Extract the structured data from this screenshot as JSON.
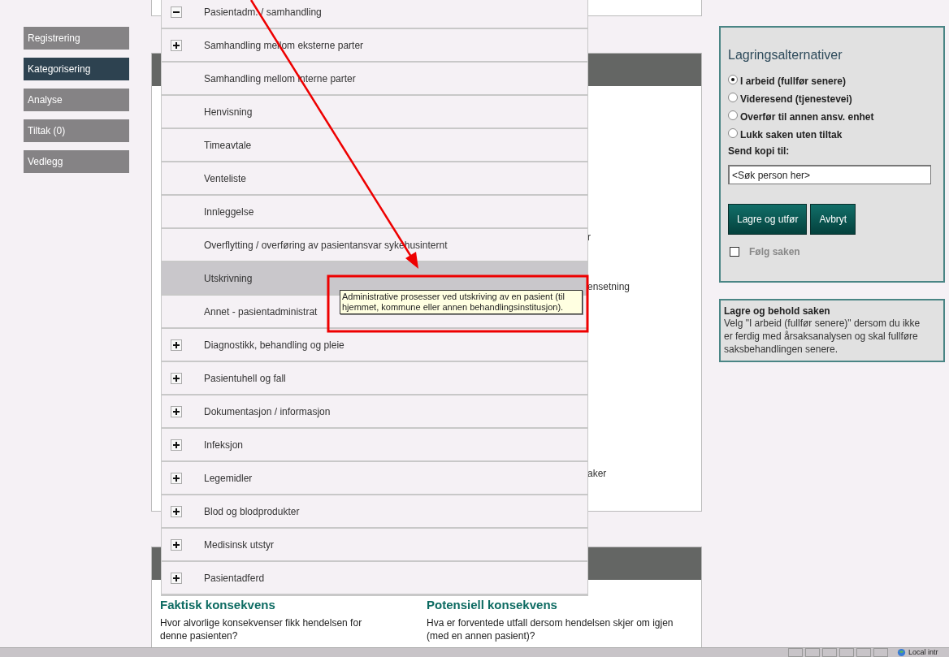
{
  "nav": [
    {
      "label": "Registrering",
      "selected": false
    },
    {
      "label": "Kategorisering",
      "selected": true
    },
    {
      "label": "Analyse",
      "selected": false
    },
    {
      "label": "Tiltak (0)",
      "selected": false
    },
    {
      "label": "Vedlegg",
      "selected": false
    }
  ],
  "background_fragments": [
    "r",
    "ensetning",
    "aker"
  ],
  "category_dropdown": {
    "items": [
      {
        "label": "Pasientadm. / samhandling",
        "kind": "group",
        "expanded": true,
        "selected": false
      },
      {
        "label": "Samhandling mellom eksterne parter",
        "kind": "group",
        "expanded": false,
        "selected": false
      },
      {
        "label": "Samhandling mellom interne parter",
        "kind": "leaf",
        "selected": false
      },
      {
        "label": "Henvisning",
        "kind": "leaf",
        "selected": false
      },
      {
        "label": "Timeavtale",
        "kind": "leaf",
        "selected": false
      },
      {
        "label": "Venteliste",
        "kind": "leaf",
        "selected": false
      },
      {
        "label": "Innleggelse",
        "kind": "leaf",
        "selected": false
      },
      {
        "label": "Overflytting / overføring av pasientansvar sykehusinternt",
        "kind": "leaf",
        "selected": false
      },
      {
        "label": "Utskrivning",
        "kind": "leaf",
        "selected": true
      },
      {
        "label": "Annet - pasientadministrat",
        "kind": "leaf",
        "selected": false
      },
      {
        "label": "Diagnostikk, behandling og pleie",
        "kind": "group",
        "expanded": false,
        "selected": false
      },
      {
        "label": "Pasientuhell og fall",
        "kind": "group",
        "expanded": false,
        "selected": false
      },
      {
        "label": "Dokumentasjon / informasjon",
        "kind": "group",
        "expanded": false,
        "selected": false
      },
      {
        "label": "Infeksjon",
        "kind": "group",
        "expanded": false,
        "selected": false
      },
      {
        "label": "Legemidler",
        "kind": "group",
        "expanded": false,
        "selected": false
      },
      {
        "label": "Blod og blodprodukter",
        "kind": "group",
        "expanded": false,
        "selected": false
      },
      {
        "label": "Medisinsk utstyr",
        "kind": "group",
        "expanded": false,
        "selected": false
      },
      {
        "label": "Pasientadferd",
        "kind": "group",
        "expanded": false,
        "selected": false
      }
    ],
    "tooltip": "Administrative prosesser ved utskriving av en pasient (til hjemmet, kommune eller annen behandlingsinstitusjon)."
  },
  "consequences": [
    {
      "title": "Faktisk konsekvens",
      "question": "Hvor alvorlige konsekvenser fikk hendelsen for denne pasienten?"
    },
    {
      "title": "Potensiell konsekvens",
      "question": "Hva er forventede utfall dersom hendelsen skjer om igjen (med en annen pasient)?"
    }
  ],
  "save_panel": {
    "title": "Lagringsalternativer",
    "options": [
      {
        "label": "I arbeid (fullfør senere)",
        "selected": true
      },
      {
        "label": "Videresend (tjenestevei)",
        "selected": false
      },
      {
        "label": "Overfør til annen ansv. enhet",
        "selected": false
      },
      {
        "label": "Lukk saken uten tiltak",
        "selected": false
      }
    ],
    "copy_label": "Send kopi til:",
    "copy_field": {
      "placeholder": "<Søk person her>"
    },
    "buttons": [
      "Lagre og utfør",
      "Avbryt"
    ],
    "follow": {
      "label": "Følg saken",
      "checked": false,
      "disabled": true
    }
  },
  "info_box": {
    "title": "Lagre og behold saken",
    "text": "Velg \"I arbeid (fullfør senere)\" dersom du ikke er ferdig med årsaksanalysen og skal fullføre saksbehandlingen senere."
  },
  "status_bar": {
    "zone": "Local intr"
  }
}
